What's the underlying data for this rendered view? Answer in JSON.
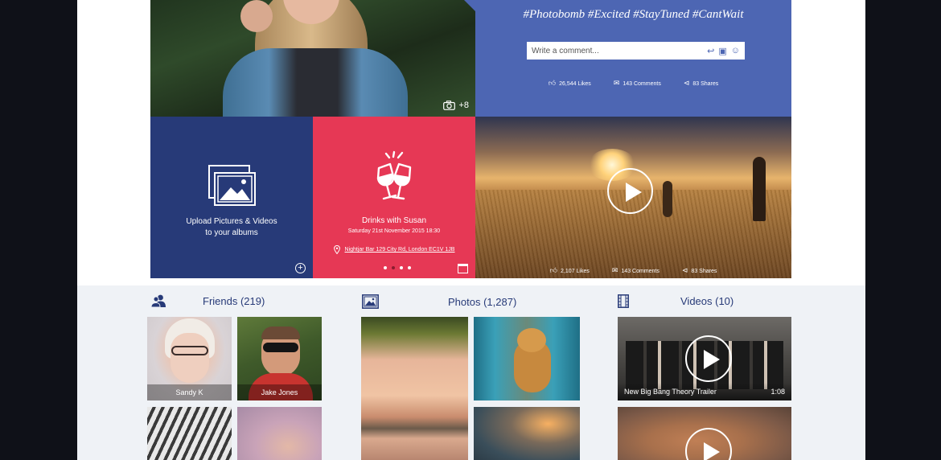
{
  "post": {
    "photo_count": "+8",
    "hashtags": "#Photobomb #Excited #StayTuned #CantWait",
    "comment_placeholder": "Write a comment...",
    "likes": "26,544 Likes",
    "comments": "143 Comments",
    "shares": "83 Shares"
  },
  "upload": {
    "line1": "Upload Pictures & Videos",
    "line2": "to your albums"
  },
  "event": {
    "title": "Drinks with Susan",
    "date": "Saturday 21st November 2015 18:30",
    "location": "Nightjar Bar 129 City Rd, London EC1V 1JB"
  },
  "video_post": {
    "likes": "2,107 Likes",
    "comments": "143 Comments",
    "shares": "83 Shares"
  },
  "friends": {
    "title": "Friends (219)",
    "items": [
      {
        "name": "Sandy K"
      },
      {
        "name": "Jake Jones"
      }
    ]
  },
  "photos": {
    "title": "Photos (1,287)"
  },
  "videos": {
    "title": "Videos (10)",
    "items": [
      {
        "title": "New Big Bang Theory Trailer",
        "duration": "1:08"
      }
    ]
  },
  "icons": {
    "camera": "camera-icon",
    "like": "thumbs-up-icon",
    "comment": "speech-bubble-icon",
    "share": "share-icon",
    "image": "image-icon",
    "cheers": "cheers-glasses-icon",
    "pin": "map-pin-icon",
    "calendar": "calendar-icon",
    "friends": "friends-icon",
    "film": "film-icon",
    "play": "play-icon"
  },
  "colors": {
    "navy": "#273a78",
    "blue": "#4d66b3",
    "red": "#e63855",
    "light_bg": "#eff2f6"
  }
}
